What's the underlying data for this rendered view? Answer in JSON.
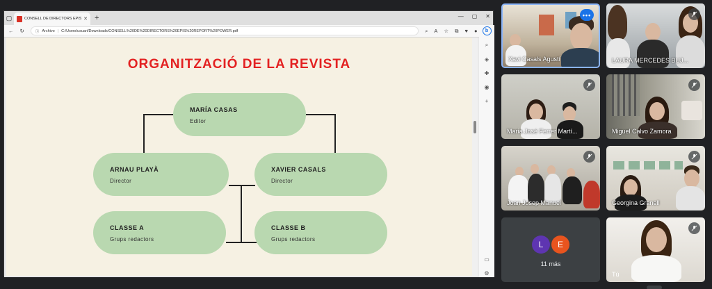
{
  "browser": {
    "tab_title": "CONSELL DE DIRECTORS EPIS R",
    "address_label": "Archivo",
    "url": "C:/Users/usuari/Downloads/CONSELL%20DE%20DIRECTORS%20EPIS%20REPORT%20POWER.pdf",
    "new_tab": "+",
    "bing_label": "b"
  },
  "slide": {
    "title": "ORGANITZACIÓ DE LA REVISTA",
    "nodes": [
      {
        "name": "MARÍA CASAS",
        "role": "Editor"
      },
      {
        "name": "ARNAU PLAYÀ",
        "role": "Director"
      },
      {
        "name": "XAVIER CASALS",
        "role": "Director"
      },
      {
        "name": "CLASSE A",
        "role": "Grups redactors"
      },
      {
        "name": "CLASSE B",
        "role": "Grups redactors"
      }
    ]
  },
  "meet": {
    "participants": [
      {
        "name": "Xavi Casals Agustí",
        "selected": true
      },
      {
        "name": "LAURA MERCEDES BUJ...",
        "muted": true
      },
      {
        "name": "Maria José Ferrer Martí...",
        "muted": true
      },
      {
        "name": "Miguel Calvo Zamora",
        "muted": true
      },
      {
        "name": "Joan Josep Manuel",
        "muted": true
      },
      {
        "name": "Georgina Granell",
        "muted": true
      }
    ],
    "overflow": {
      "avatars": [
        "L",
        "E"
      ],
      "avatar_colors": [
        "#5e35b1",
        "#e8541e"
      ],
      "count_label": "11 más"
    },
    "self_label": "Tú"
  },
  "colors": {
    "title_red": "#e32222",
    "node_green": "#b9d8b0",
    "slide_bg": "#f6f1e3",
    "meet_bg": "#202124",
    "accent_blue": "#1a73e8"
  }
}
